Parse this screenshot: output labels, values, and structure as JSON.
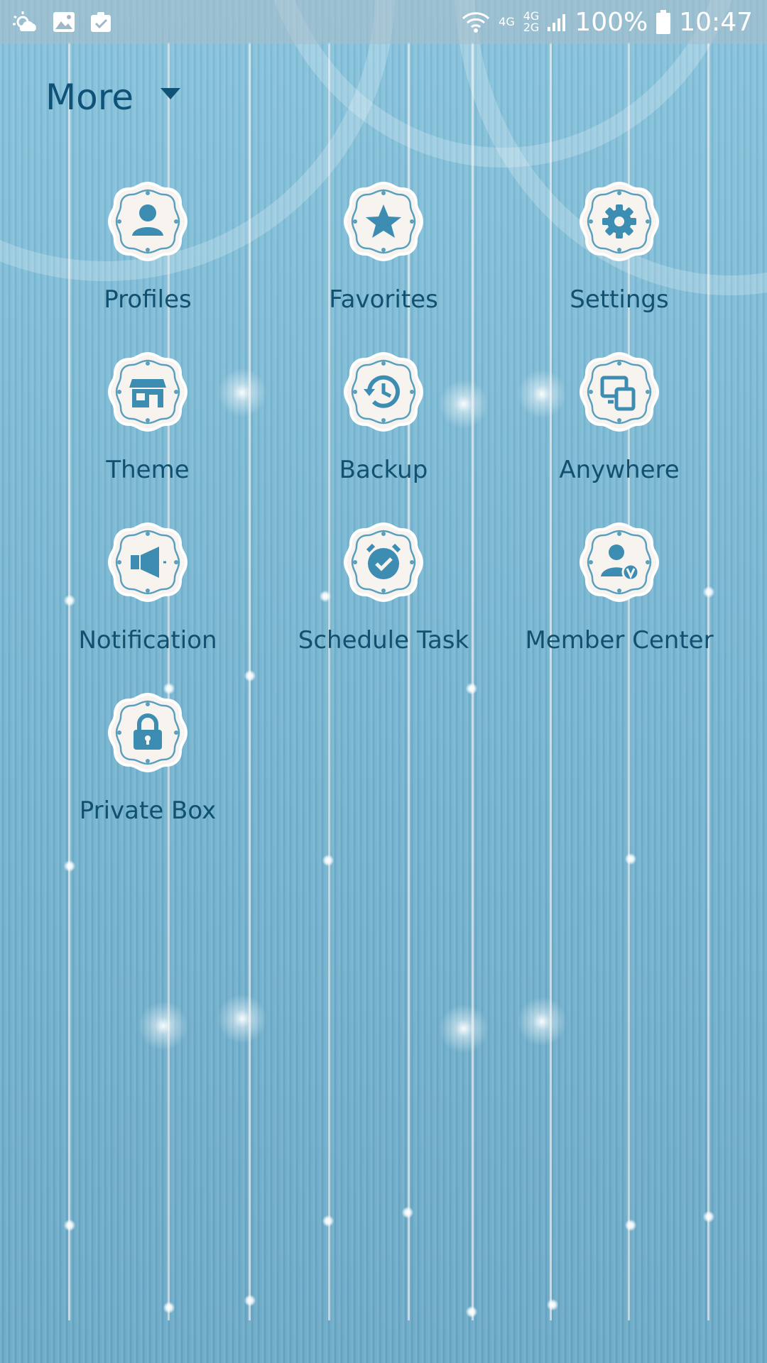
{
  "status_bar": {
    "icons": [
      "weather-icon",
      "image-icon",
      "clipboard-check-icon"
    ],
    "network_1": "4G",
    "network_2_top": "4G",
    "network_2_bottom": "2G",
    "battery": "100%",
    "time": "10:47"
  },
  "header": {
    "title": "More"
  },
  "items": [
    {
      "label": "Profiles",
      "icon": "person-icon"
    },
    {
      "label": "Favorites",
      "icon": "star-icon"
    },
    {
      "label": "Settings",
      "icon": "gear-icon"
    },
    {
      "label": "Theme",
      "icon": "shop-icon"
    },
    {
      "label": "Backup",
      "icon": "history-icon"
    },
    {
      "label": "Anywhere",
      "icon": "devices-icon"
    },
    {
      "label": "Notification",
      "icon": "speaker-icon"
    },
    {
      "label": "Schedule Task",
      "icon": "alarm-check-icon"
    },
    {
      "label": "Member Center",
      "icon": "member-icon"
    },
    {
      "label": "Private Box",
      "icon": "lock-icon"
    }
  ],
  "colors": {
    "text": "#11506f",
    "icon": "#3d8db3",
    "badge_fill": "#f7f4f0"
  }
}
